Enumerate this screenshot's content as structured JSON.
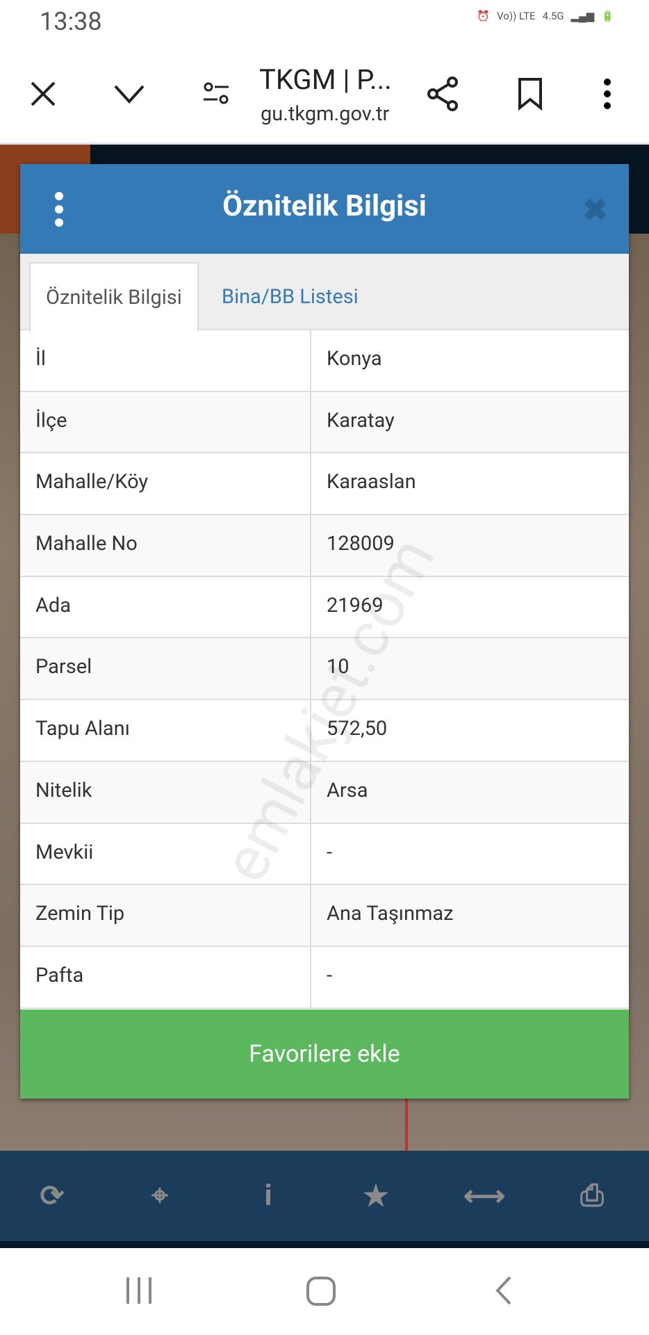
{
  "status": {
    "time": "13:38",
    "network": "Vo)) LTE",
    "speed": "4.5G"
  },
  "browser": {
    "title": "TKGM | P...",
    "url": "gu.tkgm.gov.tr"
  },
  "dialog": {
    "title": "Öznitelik Bilgisi",
    "tabs": [
      {
        "label": "Öznitelik Bilgisi",
        "active": true
      },
      {
        "label": "Bina/BB Listesi",
        "active": false
      }
    ],
    "rows": [
      {
        "key": "İl",
        "value": "Konya"
      },
      {
        "key": "İlçe",
        "value": "Karatay"
      },
      {
        "key": "Mahalle/Köy",
        "value": "Karaaslan"
      },
      {
        "key": "Mahalle No",
        "value": "128009"
      },
      {
        "key": "Ada",
        "value": "21969"
      },
      {
        "key": "Parsel",
        "value": "10"
      },
      {
        "key": "Tapu Alanı",
        "value": "572,50"
      },
      {
        "key": "Nitelik",
        "value": "Arsa"
      },
      {
        "key": "Mevkii",
        "value": "-"
      },
      {
        "key": "Zemin Tip",
        "value": "Ana Taşınmaz"
      },
      {
        "key": "Pafta",
        "value": "-"
      }
    ],
    "fav_button": "Favorilere ekle",
    "watermark": "emlakjet.com"
  },
  "colors": {
    "header": "#337ab7",
    "button": "#5cb85c",
    "bottom_bar": "#1c3c5c"
  }
}
